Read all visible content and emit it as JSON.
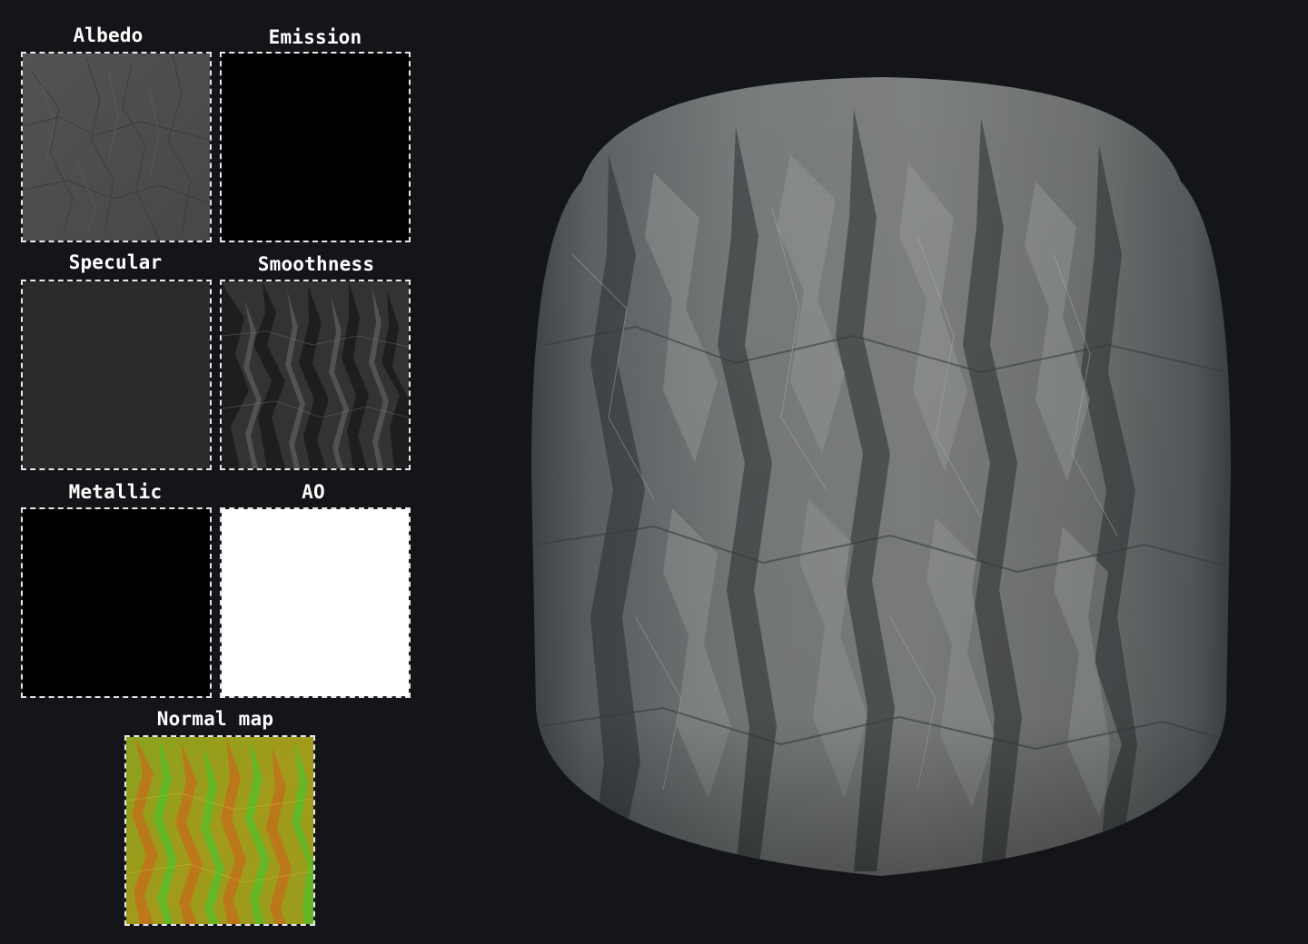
{
  "maps": {
    "albedo": {
      "label": "Albedo",
      "color": "#4c4c4c"
    },
    "emission": {
      "label": "Emission",
      "color": "#000000"
    },
    "specular": {
      "label": "Specular",
      "color": "#2a2a2a"
    },
    "smoothness": {
      "label": "Smoothness",
      "color": "#3a3a3a"
    },
    "metallic": {
      "label": "Metallic",
      "color": "#000000"
    },
    "ao": {
      "label": "AO",
      "color": "#ffffff"
    },
    "normal": {
      "label": "Normal map",
      "color": "#8f9a1e"
    }
  },
  "preview": {
    "shape": "cylinder",
    "material": "rock"
  }
}
